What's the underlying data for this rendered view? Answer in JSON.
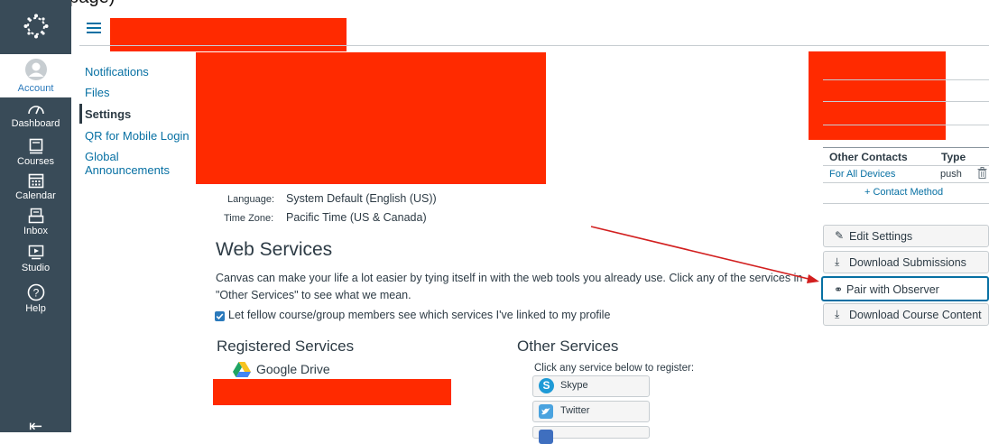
{
  "top_heading": "r profile page)",
  "global_nav": [
    {
      "label": "Account"
    },
    {
      "label": "Dashboard"
    },
    {
      "label": "Courses"
    },
    {
      "label": "Calendar"
    },
    {
      "label": "Inbox"
    },
    {
      "label": "Studio"
    },
    {
      "label": "Help"
    }
  ],
  "collapse_icon": "⇤",
  "left_nav": [
    {
      "label": "Notifications"
    },
    {
      "label": "Files"
    },
    {
      "label": "Settings"
    },
    {
      "label": "QR for Mobile Login"
    },
    {
      "label": "Global Announcements"
    }
  ],
  "profile": {
    "language_label": "Language:",
    "language_value": "System Default (English (US))",
    "timezone_label": "Time Zone:",
    "timezone_value": "Pacific Time (US & Canada)"
  },
  "web_services": {
    "title": "Web Services",
    "description": "Canvas can make your life a lot easier by tying itself in with the web tools you already use. Click any of the services in \"Other Services\" to see what we mean.",
    "share_label": "Let fellow course/group members see which services I've linked to my profile",
    "registered_title": "Registered Services",
    "registered": [
      {
        "label": "Google Drive"
      }
    ],
    "other_title": "Other Services",
    "other_hint": "Click any service below to register:",
    "other": [
      {
        "label": "Skype",
        "color": "#1e9ad6"
      },
      {
        "label": "Twitter",
        "color": "#4aa3df"
      }
    ]
  },
  "contacts": {
    "header_col1": "Other Contacts",
    "header_col2": "Type",
    "row_name": "For All Devices",
    "row_type": "push",
    "add_method": "+ Contact Method"
  },
  "actions": {
    "edit_settings": "Edit Settings",
    "download_submissions": "Download Submissions",
    "pair_observer": "Pair with Observer",
    "download_course_content": "Download Course Content"
  },
  "colors": {
    "nav_bg": "#394b58",
    "link": "#0770a3",
    "redaction": "#ff2a00",
    "arrow": "#d21f1f"
  }
}
